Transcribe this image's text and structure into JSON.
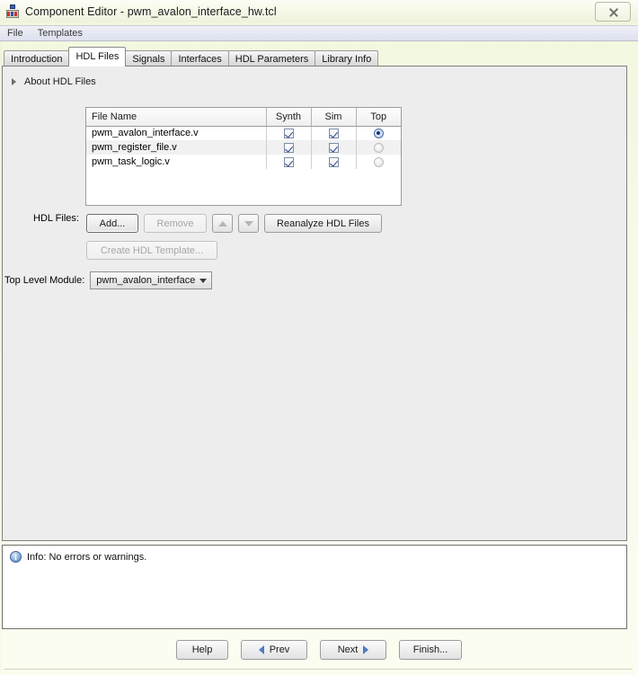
{
  "window": {
    "title": "Component Editor - pwm_avalon_interface_hw.tcl",
    "app_icon": "component-editor-icon",
    "close_label": "Close",
    "close_icon": "close-icon"
  },
  "menubar": {
    "items": [
      {
        "label": "File"
      },
      {
        "label": "Templates"
      }
    ]
  },
  "tabs": [
    {
      "label": "Introduction",
      "active": false
    },
    {
      "label": "HDL Files",
      "active": true
    },
    {
      "label": "Signals",
      "active": false
    },
    {
      "label": "Interfaces",
      "active": false
    },
    {
      "label": "HDL Parameters",
      "active": false
    },
    {
      "label": "Library Info",
      "active": false
    }
  ],
  "main": {
    "about": {
      "label": "About HDL Files",
      "expander_icon": "triangle-right-icon",
      "expanded": false
    },
    "hdl_files_label": "HDL Files:",
    "table": {
      "columns": [
        "File Name",
        "Synth",
        "Sim",
        "Top"
      ],
      "rows": [
        {
          "file_name": "pwm_avalon_interface.v",
          "synth": true,
          "sim": true,
          "top": true,
          "top_enabled": true
        },
        {
          "file_name": "pwm_register_file.v",
          "synth": true,
          "sim": true,
          "top": false,
          "top_enabled": false
        },
        {
          "file_name": "pwm_task_logic.v",
          "synth": true,
          "sim": true,
          "top": false,
          "top_enabled": false
        }
      ]
    },
    "buttons": {
      "add": {
        "label": "Add...",
        "enabled": true
      },
      "remove": {
        "label": "Remove",
        "enabled": false
      },
      "move_up": {
        "label": "",
        "icon": "triangle-up-icon",
        "enabled": false
      },
      "move_down": {
        "label": "",
        "icon": "triangle-down-icon",
        "enabled": false
      },
      "reanalyze": {
        "label": "Reanalyze HDL Files",
        "enabled": true
      },
      "create_template": {
        "label": "Create HDL Template...",
        "enabled": false
      }
    },
    "top_level_module": {
      "label": "Top Level Module:",
      "value": "pwm_avalon_interface",
      "dropdown_icon": "chevron-down-icon"
    }
  },
  "status": {
    "icon": "info-icon",
    "icon_glyph": "i",
    "message": "Info: No errors or warnings."
  },
  "footer": {
    "help": {
      "label": "Help"
    },
    "prev": {
      "label": "Prev",
      "icon": "triangle-left-icon"
    },
    "next": {
      "label": "Next",
      "icon": "triangle-right-icon"
    },
    "finish": {
      "label": "Finish..."
    }
  },
  "colors": {
    "accent_blue": "#4f79c8",
    "checkbox_check": "#28447e",
    "panel_bg": "#ededed",
    "window_bg": "#f4f8e4"
  }
}
